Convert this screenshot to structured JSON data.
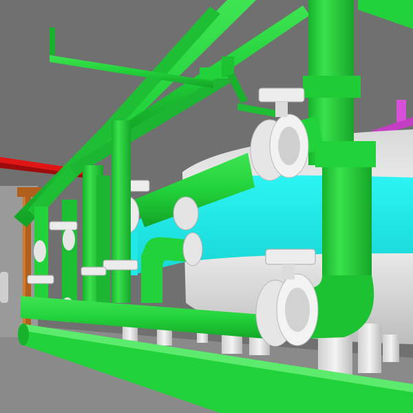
{
  "scene": {
    "subject": "3d-piping-render",
    "colors": {
      "background": "#707070",
      "pipe": "#22d43a",
      "pipe_shadow": "#129a22",
      "pipe_highlight": "#6df07c",
      "tank_band": "#1ff0f0",
      "tank_body": "#e6e6e6",
      "valve": "#ececec",
      "red_pipe": "#e01515",
      "brown_pipe": "#b0601c",
      "magenta_pipe": "#d84fd8"
    }
  }
}
